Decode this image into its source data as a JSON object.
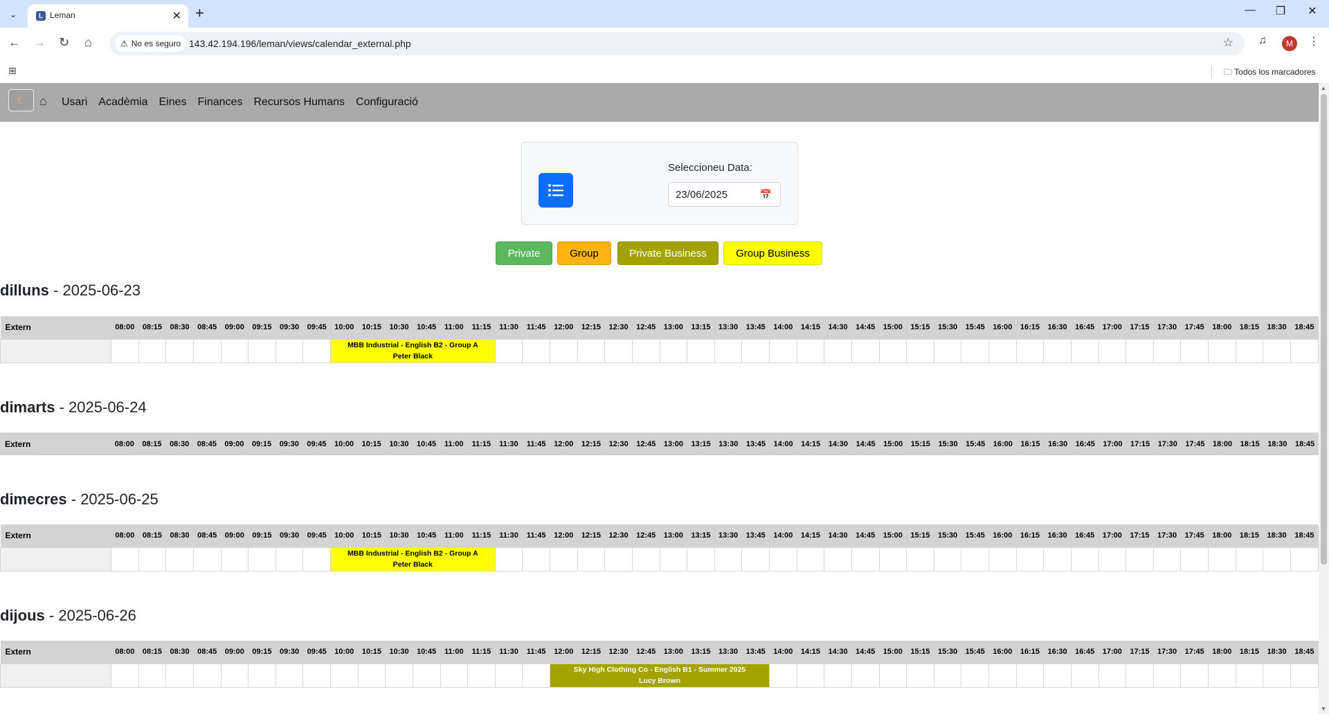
{
  "browser": {
    "tab_title": "Leman",
    "security_label": "No es seguro",
    "url": "143.42.194.196/leman/views/calendar_external.php",
    "bookmarks_label": "Todos los marcadores",
    "profile_initial": "M"
  },
  "nav": {
    "items": [
      "Usari",
      "Acadèmia",
      "Eines",
      "Finances",
      "Recursos Humans",
      "Configuració"
    ]
  },
  "filter": {
    "date_label": "Seleccioneu Data:",
    "date_value": "23/06/2025"
  },
  "legend": [
    {
      "label": "Private",
      "bg": "#5cb85c",
      "fg": "#ffffff"
    },
    {
      "label": "Group",
      "bg": "#ffb30f",
      "fg": "#000000"
    },
    {
      "label": "Private Business",
      "bg": "#a3a300",
      "fg": "#ffffff"
    },
    {
      "label": "Group Business",
      "bg": "#ffff00",
      "fg": "#000000"
    }
  ],
  "row_label": "Extern",
  "times": [
    "08:00",
    "08:15",
    "08:30",
    "08:45",
    "09:00",
    "09:15",
    "09:30",
    "09:45",
    "10:00",
    "10:15",
    "10:30",
    "10:45",
    "11:00",
    "11:15",
    "11:30",
    "11:45",
    "12:00",
    "12:15",
    "12:30",
    "12:45",
    "13:00",
    "13:15",
    "13:30",
    "13:45",
    "14:00",
    "14:15",
    "14:30",
    "14:45",
    "15:00",
    "15:15",
    "15:30",
    "15:45",
    "16:00",
    "16:15",
    "16:30",
    "16:45",
    "17:00",
    "17:15",
    "17:30",
    "17:45",
    "18:00",
    "18:15",
    "18:30",
    "18:45"
  ],
  "days": [
    {
      "name": "dilluns",
      "date": "2025-06-23",
      "rows": [
        {
          "events": [
            {
              "start": 8,
              "span": 6,
              "title": "MBB Industrial - English B2 - Group A",
              "teacher": "Peter Black",
              "bg": "#ffff00",
              "fg": "#000000"
            }
          ]
        }
      ]
    },
    {
      "name": "dimarts",
      "date": "2025-06-24",
      "rows": []
    },
    {
      "name": "dimecres",
      "date": "2025-06-25",
      "rows": [
        {
          "events": [
            {
              "start": 8,
              "span": 6,
              "title": "MBB Industrial - English B2 - Group A",
              "teacher": "Peter Black",
              "bg": "#ffff00",
              "fg": "#000000"
            }
          ]
        }
      ]
    },
    {
      "name": "dijous",
      "date": "2025-06-26",
      "rows": [
        {
          "events": [
            {
              "start": 16,
              "span": 8,
              "title": "Sky High Clothing Co - English B1 - Summer 2025",
              "teacher": "Lucy Brown",
              "bg": "#a3a300",
              "fg": "#ffffff"
            }
          ]
        }
      ]
    }
  ]
}
